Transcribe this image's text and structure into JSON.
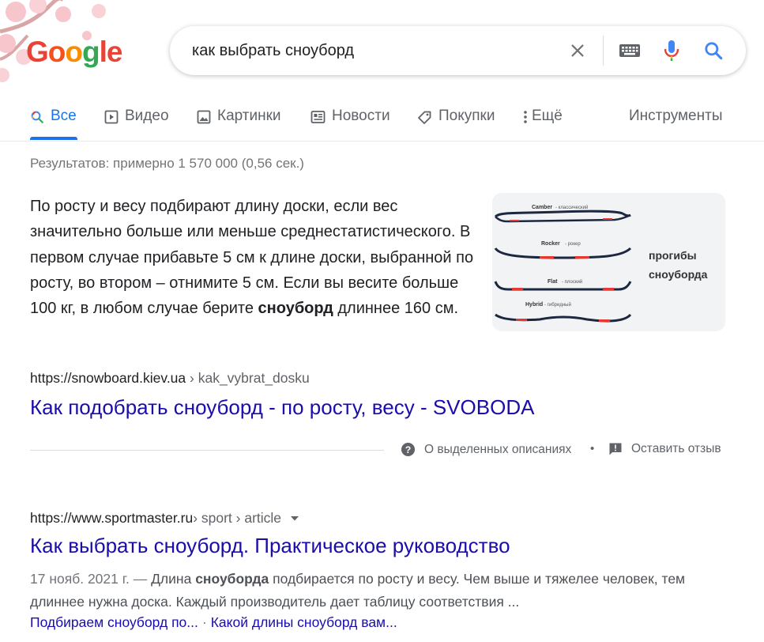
{
  "logo": {
    "text": "Google"
  },
  "search": {
    "query": "как выбрать сноуборд"
  },
  "tabs": [
    {
      "label": "Все",
      "icon": "search-icon"
    },
    {
      "label": "Видео",
      "icon": "video-icon"
    },
    {
      "label": "Картинки",
      "icon": "image-icon"
    },
    {
      "label": "Новости",
      "icon": "news-icon"
    },
    {
      "label": "Покупки",
      "icon": "tag-icon"
    },
    {
      "label": "Ещё",
      "icon": "more-vert-icon"
    }
  ],
  "tools_label": "Инструменты",
  "stats": "Результатов: примерно 1 570 000 (0,56 сек.)",
  "featured": {
    "text_before": "По росту и весу подбирают длину доски, если вес значительно больше или меньше среднестатистического. В первом случае прибавьте 5 см к длине доски, выбранной по росту, во втором – отнимите 5 см. Если вы весите больше 100 кг, в любом случае берите ",
    "text_bold": "сноуборд",
    "text_after": " длиннее 160 см.",
    "image": {
      "labels": [
        "Camber",
        "Rocker",
        "Flat",
        "Hybrid"
      ],
      "sublabels": [
        "- классический",
        "- рокер",
        "- плоский",
        "- гибридный"
      ],
      "caption_line1": "прогибы",
      "caption_line2": "сноуборда"
    },
    "url_domain": "https://snowboard.kiev.ua",
    "url_path": " › kak_vybrat_dosku",
    "title": "Как подобрать сноуборд - по росту, весу - SVOBODA",
    "about_label": "О выделенных описаниях",
    "bullet": "•",
    "feedback_label": "Оставить отзыв"
  },
  "result2": {
    "url_domain": "https://www.sportmaster.ru",
    "url_path": " › sport › article",
    "title": "Как выбрать сноуборд. Практическое руководство",
    "date": "17 нояб. 2021 г. — ",
    "desc_before": "Длина ",
    "desc_bold": "сноуборда",
    "desc_after": " подбирается по росту и весу. Чем выше и тяжелее человек, тем длиннее нужна доска. Каждый производитель дает таблицу соответствия ...",
    "sitelinks": [
      "Подбираем сноуборд по...",
      "Какой длины сноуборд вам..."
    ],
    "sitelink_sep": "·"
  },
  "colors": {
    "link": "#1a0dab",
    "accent": "#1a73e8",
    "text": "#202124",
    "muted": "#70757a"
  }
}
